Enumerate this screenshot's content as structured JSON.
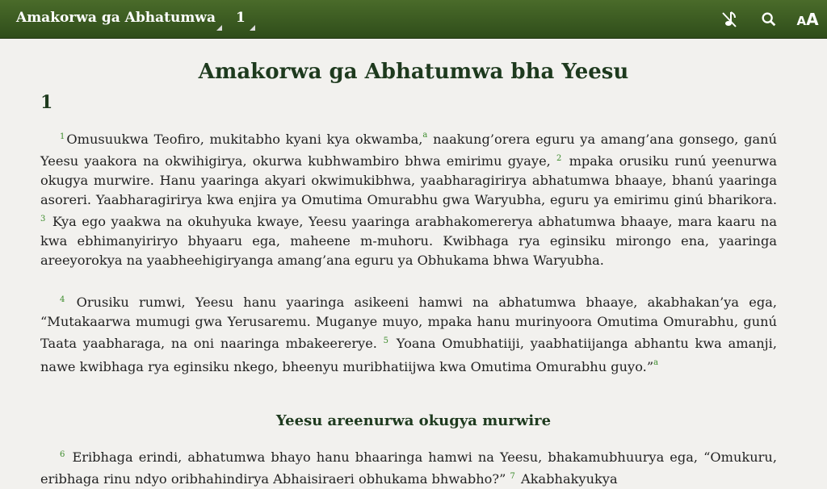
{
  "toolbar": {
    "book": "Amakorwa ga Abhatumwa",
    "chapter": "1",
    "icons": [
      "audio-off-icon",
      "search-icon",
      "text-size-icon"
    ],
    "text_size_label": "AA"
  },
  "content": {
    "book_title": "Amakorwa ga Abhatumwa bha Yeesu",
    "chapter_number": "1",
    "paragraphs": [
      {
        "v1": "1",
        "t1": "Omusuukwa Teofiro, mukitabho kyani kya okwamba,",
        "fn1": "a",
        "t1b": " naakung’orera eguru ya amang’ana gonsego, ganú Yeesu yaakora na okwihigirya, okurwa kubhwambiro bhwa emirimu gyaye, ",
        "v2": "2",
        "t2": " mpaka orusiku runú yeenurwa okugya murwire. Hanu yaaringa akyari okwimukibhwa, yaabharagirirya abhatumwa bhaaye, bhanú yaaringa asoreri. Yaabharagirirya kwa enjira ya Omutima Omurabhu gwa Waryubha, eguru ya emirimu ginú bharikora. ",
        "v3": "3",
        "t3": " Kya ego yaakwa na okuhyuka kwaye, Yeesu yaaringa arabhakomererya abhatumwa bhaaye, mara kaaru na kwa ebhimanyiriryo bhyaaru ega, maheene m-muhoru. Kwibhaga rya eginsiku mirongo ena, yaaringa areeyorokya na yaabheehigiryanga amang’ana eguru ya Obhukama bhwa Waryubha."
      },
      {
        "v4": "4",
        "t4": " Orusiku rumwi, Yeesu hanu yaaringa asikeeni hamwi na abhatumwa bhaaye, akabhakan’ya ega, “Mutakaarwa mumugi gwa Yerusaremu. Muganye muyo, mpaka hanu murinyoora Omutima Omurabhu, gunú Taata yaabharaga, na oni naaringa mbakeererye. ",
        "v5": "5",
        "t5": " Yoana Omubhatiiji, yaabhatiijanga abhantu kwa amanji, nawe kwibhaga rya eginsiku nkego, bheenyu muribhatiijwa kwa Omutima Omurabhu guyo.”",
        "fn2": "a"
      },
      {
        "v6": "6",
        "t6": " Eribhaga erindi, abhatumwa bhayo hanu bhaaringa hamwi na Yeesu, bhakamubhuurya ega, “Omukuru, eribhaga rinu ndyo oribhahindirya Abhaisiraeri obhukama bhwabho?” ",
        "v7": "7",
        "t7": " Akabhakyukya"
      }
    ],
    "section_heading": "Yeesu areenurwa okugya murwire"
  }
}
